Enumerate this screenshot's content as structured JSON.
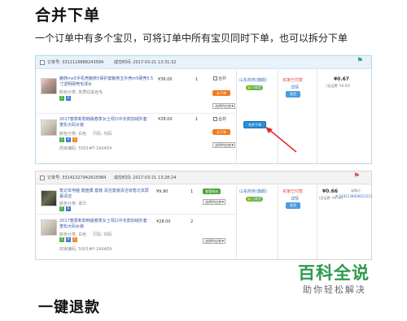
{
  "heading_merge": "合并下单",
  "intro": "一个订单中有多个宝贝，可将订单中所有宝贝同时下单，也可以拆分下单",
  "heading_refund": "一键退款",
  "order1": {
    "order_no_label": "订单号:",
    "order_no": "3311116888243584",
    "time_label": "成交时间:",
    "time": "2017-03-21 13:31:32",
    "items": [
      {
        "title": "魅族mx5手机壳魅族5保护套魅族五外壳m5硬壳5.5寸透明硬壳毛球女",
        "attr": "颜色分类: 皮质纹黑色毛",
        "price": "¥36.00",
        "qty": "1",
        "merge_label": "合并",
        "order_btn": "去下单",
        "select": "选择供应商"
      },
      {
        "title": "2017春季新款韩版春季女士领口中长款加绒外套宽松大码女装",
        "attr1": "颜色分类: 白色",
        "attr2": "尺码: 均码",
        "supplier": "商家编码: 5001#F-1A04EA",
        "price": "¥28.00",
        "qty": "1",
        "merge_label": "合并",
        "order_btn": "去下单",
        "select": "选择供应商",
        "merge_button": "合并下单"
      }
    ],
    "shop_link": "山东商务(旗舰)",
    "badge": "已收货",
    "status_red": "买家已付款",
    "detail_link": "详情",
    "ship_btn": "发货",
    "total": "¥0.67",
    "total_note": "(含运费: ¥0.00)"
  },
  "order2": {
    "order_no_label": "订单号:",
    "order_no": "33141327942625984",
    "time_label": "成交时间:",
    "time": "2017-03-21 13:28:24",
    "items": [
      {
        "title": "笔记本电脑 键盘膜 套装 清洁套装清洁液笔记本屏幕清洁",
        "attr": "颜色分类: 豪华",
        "price": "¥9.90",
        "qty": "1",
        "order_btn": "查看物流",
        "select": "选择供应商"
      },
      {
        "title": "2017春季新款韩版春季女士领口中长款加绒外套宽松大码女装",
        "attr1": "颜色分类: 白色",
        "attr2": "尺码: 均码",
        "supplier": "商家编码: 5001#F-1A04EA",
        "price": "¥28.00",
        "qty": "2",
        "select": "选择供应商"
      }
    ],
    "shop_link": "山东商务(旗舰)",
    "badge": "已收货",
    "status_red": "买家已付款",
    "detail_link": "详情",
    "ship_btn": "发货",
    "total": "¥0.66",
    "total_note": "(含运费: ¥0.00)",
    "logistics_label": "采购订",
    "logistics_no": "# 3192138838622512"
  },
  "watermark": {
    "title": "百科全说",
    "subtitle": "助你轻松解决"
  },
  "colors": {
    "accent_green": "#2e9a4c",
    "link_blue": "#3a6fc0",
    "orange": "#f07b1f"
  }
}
